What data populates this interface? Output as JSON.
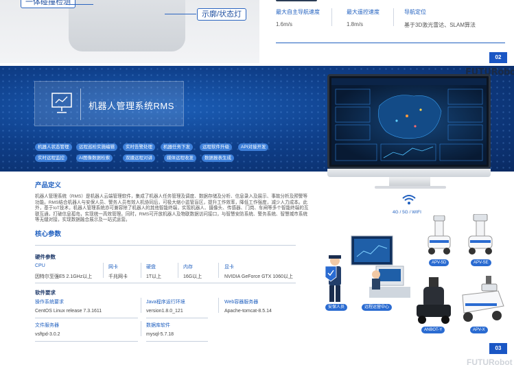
{
  "top": {
    "callout_left": "一体碰撞检测",
    "callout_right": "示廓/状态灯",
    "specs": [
      {
        "label": "最大自主导航速度",
        "value": "1.6m/s"
      },
      {
        "label": "最大遥控速度",
        "value": "1.8m/s"
      },
      {
        "label": "导航定位",
        "value": "基于3D激光雷达、SLAM算法"
      }
    ],
    "page_number": "02"
  },
  "banner": {
    "title": "机器人管理系统RMS",
    "logo": "FUTURobot",
    "tags": [
      "机器人状态管理",
      "远程巡检实施编辑",
      "实时告警处理",
      "机器任务下发",
      "远程软件升级",
      "API对接开发",
      "实时远程监控",
      "AI图像数据检索",
      "双摄远程对讲",
      "媒体远程收发",
      "数据报表生成"
    ]
  },
  "product": {
    "heading": "产品定义",
    "text": "机器人管理系统（RMS）是机器人云端管理软件，集成了机器人任务管理及调度、数据存储及分析、信息录入及展示、事故分析及预警等功能。RMS结合机器人与安保人员、警务人员有效人机协同后，可极大缩小监管盲区，提升工作效率，降低工作强度，减少人力成本。此外，基于IoT技术，机器人管理系统亦可兼容除了机器人的其他智能终端，实现机器人、摄像头、传感器、门岗、车闸等多个智能终端的互联互通，打破信息孤岛，实现统一高效管理。同时，RMS可开放机器人及物联数据访问接口，与智慧安防系统、警务系统、智慧城市系统等无缝对接，实现数据融合展示及一站式运营。"
  },
  "core": {
    "heading": "核心参数",
    "hardware_heading": "硬件参数",
    "hardware": [
      {
        "label": "CPU",
        "value": "因特尔至强E5 2.1GHz以上"
      },
      {
        "label": "网卡",
        "value": "千兆网卡"
      },
      {
        "label": "硬盘",
        "value": "1T以上"
      },
      {
        "label": "内存",
        "value": "16G以上"
      },
      {
        "label": "显卡",
        "value": "NVIDIA GeForce GTX 1060以上"
      }
    ],
    "software_heading": "软件要求",
    "software": [
      {
        "label": "操作系统要求",
        "value": "CentOS Linux release 7.3.1611"
      },
      {
        "label": "Java程序运行环境",
        "value": "version1.8.0_121"
      },
      {
        "label": "Web容器服务器",
        "value": "Apache-tomcat-8.5.14"
      },
      {
        "label": "文件服务器",
        "value": "vsftpd-3.0.2"
      },
      {
        "label": "数据库软件",
        "value": "mysql-5.7.18"
      }
    ]
  },
  "illustration": {
    "network": "4G / 5G / WIFI",
    "robots": [
      "APV-5D",
      "APV-SE",
      "ANBOT-Y",
      "APV-X"
    ],
    "people": [
      "安保人员",
      "远程运营中心"
    ]
  },
  "page_number": "03",
  "footer_logo": "FUTURobot"
}
